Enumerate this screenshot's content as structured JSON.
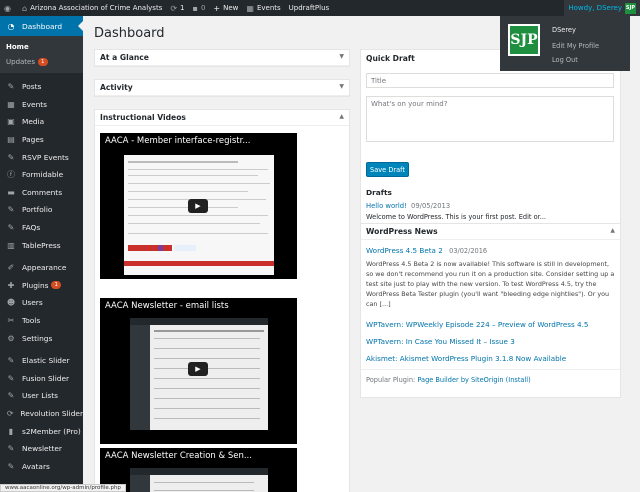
{
  "adminbar": {
    "site_name": "Arizona Association of Crime Analysts",
    "updates_count": "1",
    "comments_count": "0",
    "new_label": "New",
    "events_label": "Events",
    "plugin_label": "UpdraftPlus",
    "howdy": "Howdy, DSerey"
  },
  "account_menu": {
    "avatar_text": "SJP",
    "name": "DSerey",
    "edit_profile": "Edit My Profile",
    "log_out": "Log Out"
  },
  "sidebar": {
    "dashboard": "Dashboard",
    "home": "Home",
    "updates": "Updates",
    "updates_badge": "1",
    "items": [
      {
        "label": "Posts",
        "icon": "pin-icon"
      },
      {
        "label": "Events",
        "icon": "calendar-icon"
      },
      {
        "label": "Media",
        "icon": "media-icon"
      },
      {
        "label": "Pages",
        "icon": "page-icon"
      },
      {
        "label": "RSVP Events",
        "icon": "pin-icon"
      },
      {
        "label": "Formidable",
        "icon": "form-icon"
      },
      {
        "label": "Comments",
        "icon": "comment-icon"
      },
      {
        "label": "Portfolio",
        "icon": "pin-icon"
      },
      {
        "label": "FAQs",
        "icon": "pin-icon"
      },
      {
        "label": "TablePress",
        "icon": "table-icon"
      }
    ],
    "items2": [
      {
        "label": "Appearance",
        "icon": "brush-icon"
      },
      {
        "label": "Plugins",
        "icon": "plugin-icon",
        "badge": "1"
      },
      {
        "label": "Users",
        "icon": "users-icon"
      },
      {
        "label": "Tools",
        "icon": "tools-icon"
      },
      {
        "label": "Settings",
        "icon": "settings-icon"
      }
    ],
    "items3": [
      {
        "label": "Elastic Slider",
        "icon": "pin-icon"
      },
      {
        "label": "Fusion Slider",
        "icon": "pin-icon"
      },
      {
        "label": "User Lists",
        "icon": "pin-icon"
      },
      {
        "label": "Revolution Slider",
        "icon": "refresh-icon"
      },
      {
        "label": "s2Member (Pro)",
        "icon": "member-icon"
      },
      {
        "label": "Newsletter",
        "icon": "pin-icon"
      },
      {
        "label": "Avatars",
        "icon": "pin-icon"
      }
    ]
  },
  "page": {
    "title": "Dashboard"
  },
  "boxes": {
    "glance": "At a Glance",
    "activity": "Activity",
    "videos": "Instructional Videos",
    "quick_draft": "Quick Draft",
    "wp_news": "WordPress News"
  },
  "videos": [
    {
      "title": "AACA - Member interface-registr..."
    },
    {
      "title": "AACA Newsletter - email lists"
    },
    {
      "title": "AACA Newsletter Creation & Sen..."
    }
  ],
  "quick_draft": {
    "title_placeholder": "Title",
    "content_placeholder": "What's on your mind?",
    "save_button": "Save Draft",
    "drafts_heading": "Drafts",
    "draft_link": "Hello world!",
    "draft_date": "09/05/2013",
    "draft_excerpt": "Welcome to WordPress. This is your first post. Edit or..."
  },
  "news": {
    "main_title": "WordPress 4.5 Beta 2",
    "main_date": "03/02/2016",
    "main_excerpt": "WordPress 4.5 Beta 2 is now available! This software is still in development, so we don't recommend you run it on a production site. Consider setting up a test site just to play with the new version. To test WordPress 4.5, try the WordPress Beta Tester plugin (you'll want \"bleeding edge nightlies\"). Or you can [...]",
    "links": [
      "WPTavern: WPWeekly Episode 224 – Preview of WordPress 4.5",
      "WPTavern: In Case You Missed It – Issue 3",
      "Akismet: Akismet WordPress Plugin 3.1.8 Now Available"
    ],
    "popular_prefix": "Popular Plugin:",
    "popular_link": "Page Builder by SiteOrigin (Install)"
  },
  "statusbar": {
    "url": "www.aacaonline.org/wp-admin/profile.php"
  }
}
